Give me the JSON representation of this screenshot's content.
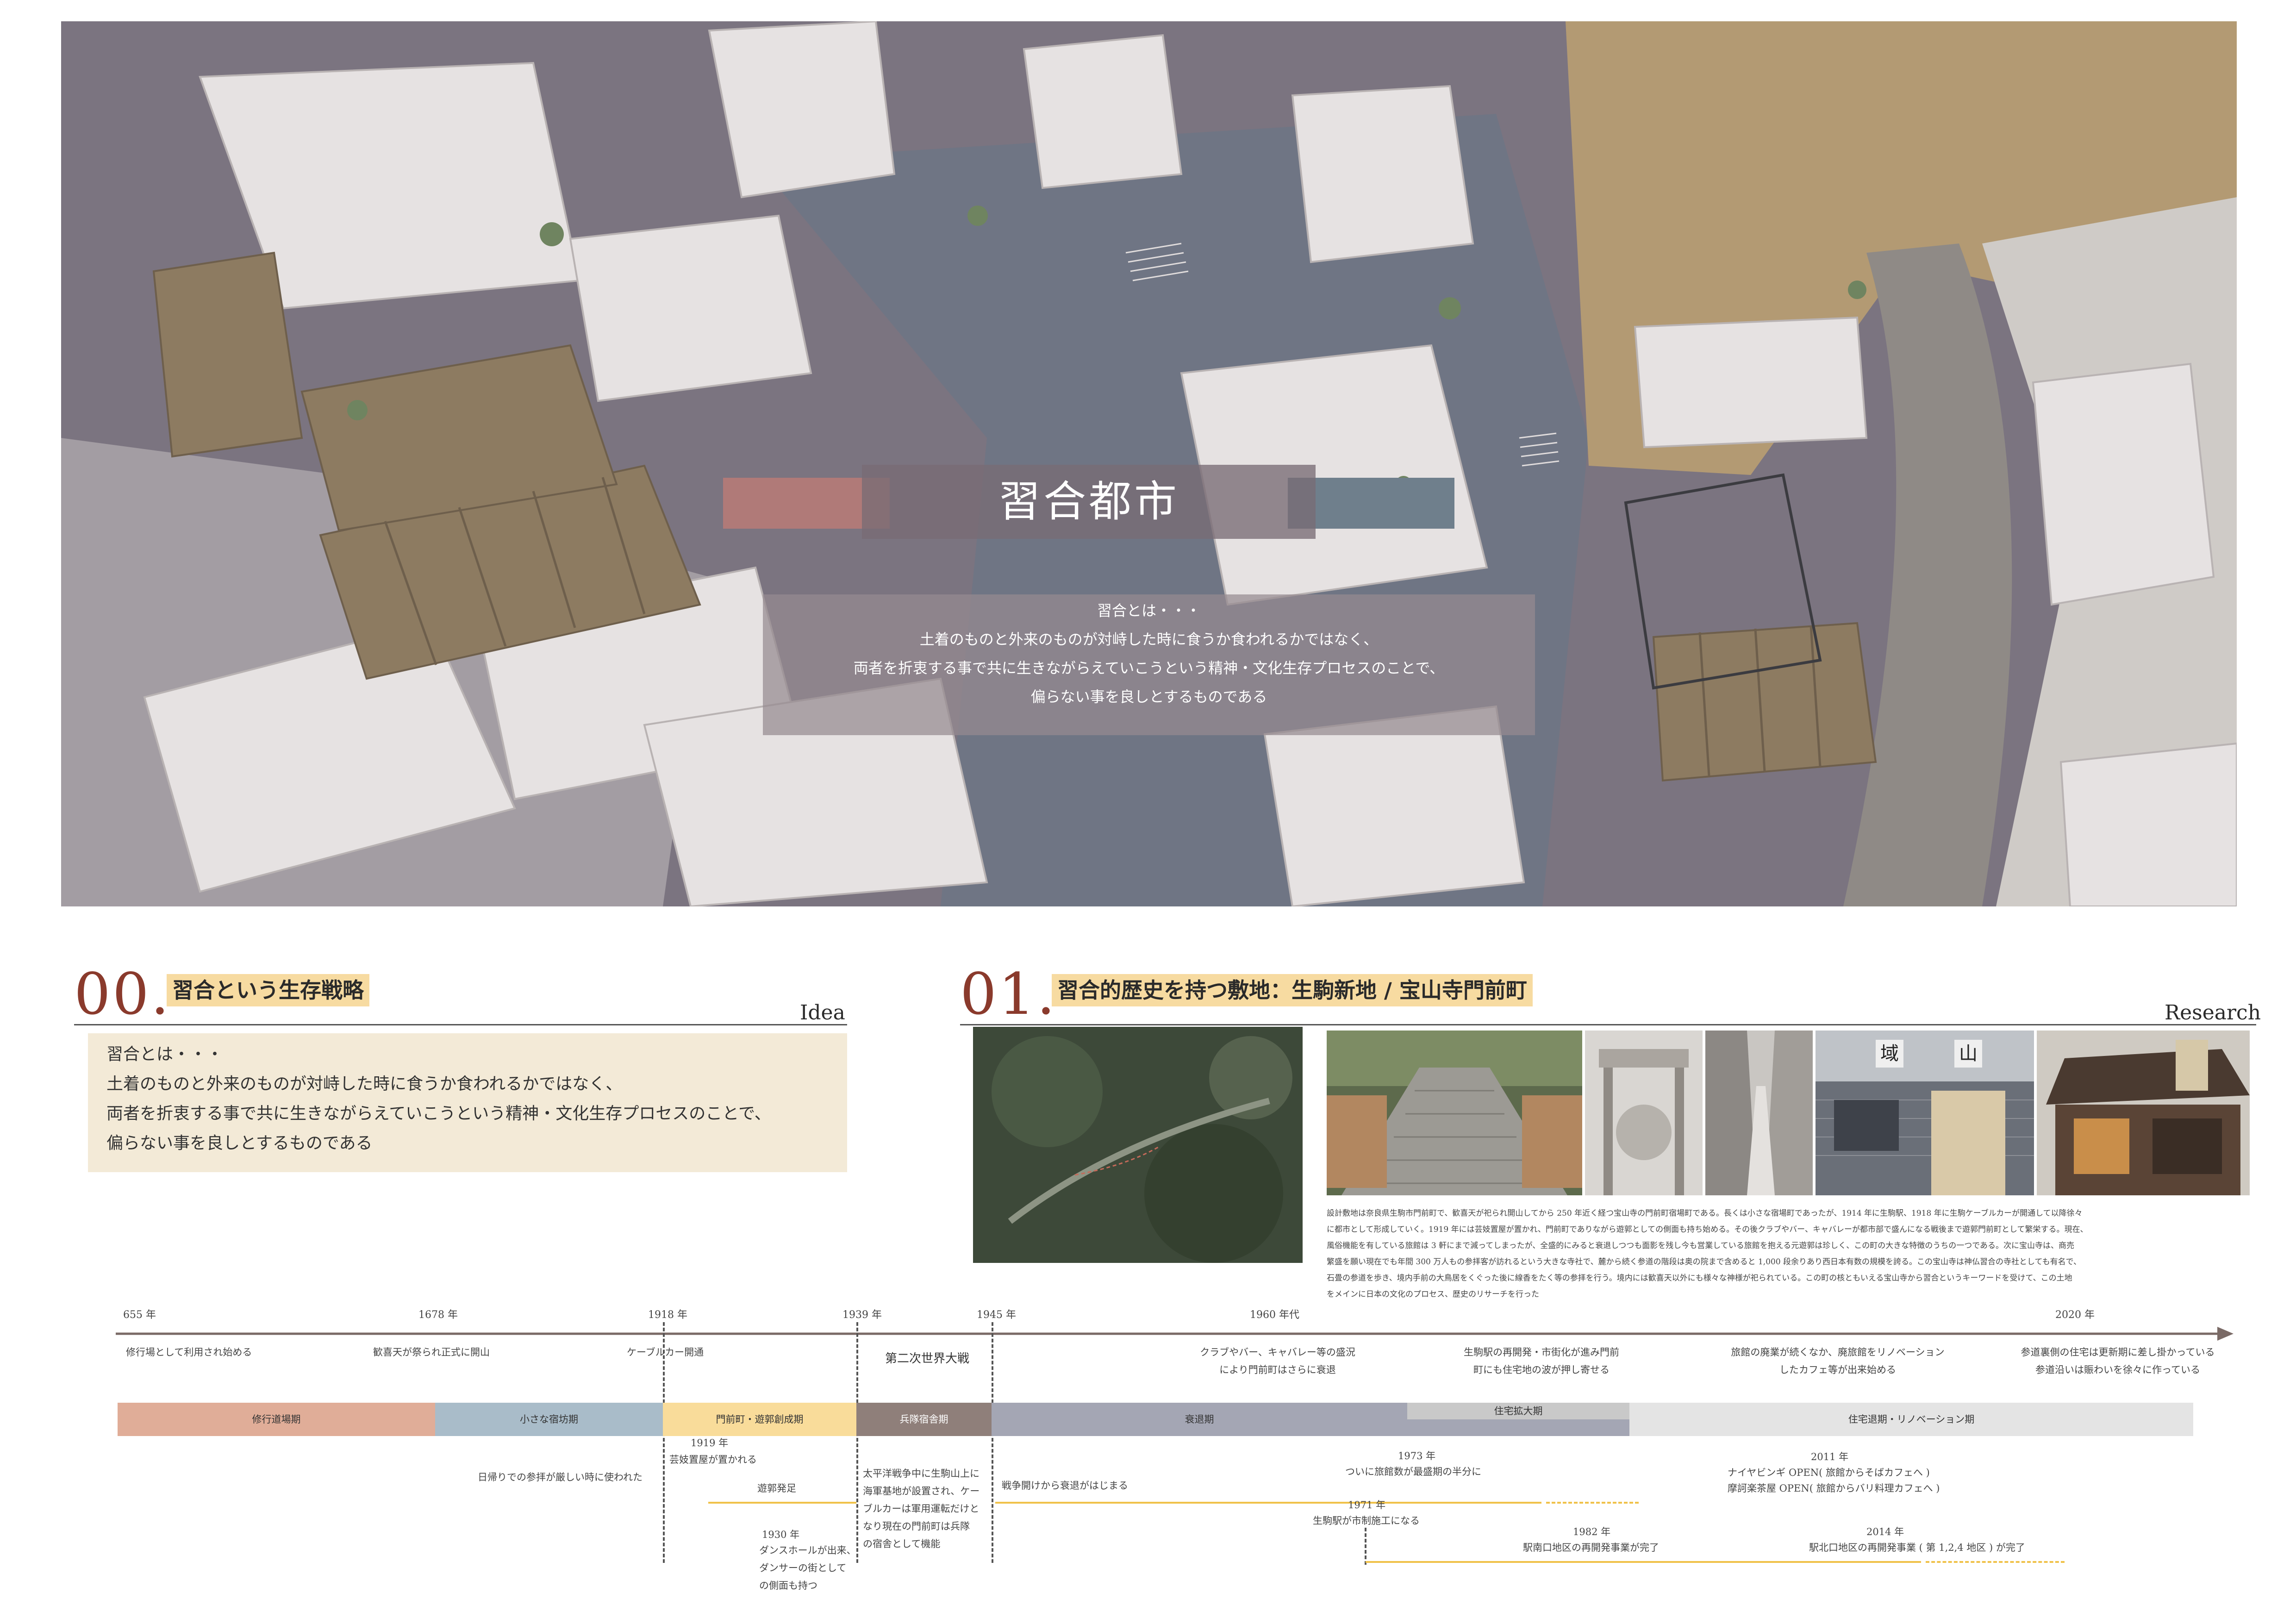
{
  "hero": {
    "title": "習合都市",
    "panel_lines": [
      "習合とは・・・",
      "土着のものと外来のものが対峙した時に食うか食われるかではなく、",
      "両者を折衷する事で共に生きながらえていこうという精神・文化生存プロセスのことで、",
      "偏らない事を良しとするものである"
    ],
    "band_colors": [
      "#b07a78",
      "#6f7f8c"
    ]
  },
  "sec0": {
    "num": "00.",
    "tag": "習合という生存戦略",
    "en": "Idea",
    "body_lines": [
      "習合とは・・・",
      "土着のものと外来のものが対峙した時に食うか食われるかではなく、",
      "両者を折衷する事で共に生きながらえていこうという精神・文化生存プロセスのことで、",
      "偏らない事を良しとするものである"
    ]
  },
  "sec1": {
    "num": "01.",
    "tag": "習合的歴史を持つ敷地：生駒新地 / 宝山寺門前町",
    "en": "Research",
    "sign1": "域",
    "sign2": "山",
    "text_lines": [
      "設計敷地は奈良県生駒市門前町で、歓喜天が祀られ開山してから 250 年近く経つ宝山寺の門前町宿場町である。長くは小さな宿場町であったが、1914 年に生駒駅、1918 年に生駒ケーブルカーが開通して以降徐々",
      "に都市として形成していく。1919 年には芸妓置屋が置かれ、門前町でありながら遊郭としての側面も持ち始める。その後クラブやバー、キャバレーが都市部で盛んになる戦後まで遊郭門前町として繁栄する。現在、",
      "風俗機能を有している旅館は 3 軒にまで減ってしまったが、全盛的にみると衰退しつつも面影を残し今も営業している旅館を抱える元遊郭は珍しく、この町の大きな特徴のうちの一つである。次に宝山寺は、商売",
      "繁盛を願い現在でも年間 300 万人もの参拝客が訪れるという大きな寺社で、麓から続く参道の階段は奥の院まで含めると 1,000 段余りあり西日本有数の規模を誇る。この宝山寺は神仏習合の寺社としても有名で、",
      "石畳の参道を歩き、境内手前の大鳥居をくぐった後に線香をたく等の参拝を行う。境内には歓喜天以外にも様々な神様が祀られている。この町の核ともいえる宝山寺から習合というキーワードを受けて、この土地",
      "をメインに日本の文化のプロセス、歴史のリサーチを行った"
    ]
  },
  "timeline": {
    "years": [
      "655 年",
      "1678 年",
      "1918 年",
      "1939 年",
      "1945 年",
      "1960 年代",
      "2020 年"
    ],
    "above_events": {
      "e655": "修行場として利用され始める",
      "e1678": "歓喜天が祭られ正式に開山",
      "e1918": "ケーブルカー開通",
      "ww2": "第二次世界大戦",
      "club": [
        "クラブやバー、キャバレー等の盛況",
        "により門前町はさらに衰退"
      ],
      "redevelop": [
        "生駒駅の再開発・市街化が進み門前",
        "町にも住宅地の波が押し寄せる"
      ],
      "renov": [
        "旅館の廃業が続くなか、廃旅館をリノベーション",
        "したカフェ等が出来始める"
      ],
      "reuse": [
        "参道裏側の住宅は更新期に差し掛かっている",
        "参道沿いは賑わいを徐々に作っている"
      ]
    },
    "periods": [
      {
        "label": "修行道場期",
        "color": "#e0ad98"
      },
      {
        "label": "小さな宿坊期",
        "color": "#a9bcc9"
      },
      {
        "label": "門前町・遊郭創成期",
        "color": "#f9dc9a"
      },
      {
        "label": "兵隊宿舎期",
        "color": "#8f7f7a"
      },
      {
        "label": "衰退期",
        "color": "#a4a6b4"
      },
      {
        "label": "住宅拡大期",
        "color": "#c9c9c9"
      },
      {
        "label": "住宅退期・リノベーション期",
        "color": "#e4e4e4"
      }
    ],
    "below_events": {
      "daytrip": "日帰りでの参拝が厳しい時に使われた",
      "y1919": "1919 年",
      "geisha": "芸妓置屋が置かれる",
      "yukaku": "遊郭発足",
      "y1930": "1930 年",
      "dance": [
        "ダンスホールが出来、",
        "ダンサーの街として",
        "の側面も持つ"
      ],
      "war": [
        "太平洋戦争中に生駒山上に",
        "海軍基地が設置され、ケー",
        "ブルカーは軍用運転だけと",
        "なり現在の門前町は兵隊",
        "の宿舎として機能"
      ],
      "postwar": "戦争開けから衰退がはじまる",
      "y1973": "1973 年",
      "halved": "ついに旅館数が最盛期の半分に",
      "y1971": "1971 年",
      "station": "生駒駅が市制施工になる",
      "y1982": "1982 年",
      "south": "駅南口地区の再開発事業が完了",
      "y2011": "2011 年",
      "cafe1": "ナイヤビンギ OPEN( 旅館からそばカフェへ )",
      "cafe2": "摩訶楽茶屋 OPEN( 旅館からバリ料理カフェへ )",
      "y2014": "2014 年",
      "north": "駅北口地区の再開発事業 ( 第 1,2,4 地区 ) が完了"
    },
    "colors": {
      "arrow": "#7a6a66",
      "gold": "#f0c24a"
    }
  }
}
